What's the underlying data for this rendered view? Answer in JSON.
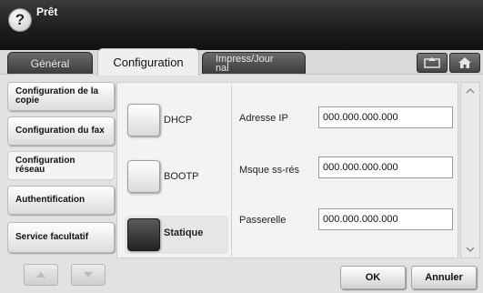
{
  "header": {
    "status": "Prêt",
    "help_symbol": "?"
  },
  "tabs": [
    {
      "label": "Général"
    },
    {
      "label": "Configuration"
    },
    {
      "label": "Impress/Jour nal"
    }
  ],
  "sidebar": {
    "items": [
      {
        "label": "Configuration de la copie"
      },
      {
        "label": "Configuration du fax"
      },
      {
        "label": "Configuration réseau"
      },
      {
        "label": "Authentification"
      },
      {
        "label": "Service facultatif"
      }
    ]
  },
  "ip_mode": {
    "options": [
      {
        "label": "DHCP"
      },
      {
        "label": "BOOTP"
      },
      {
        "label": "Statique"
      }
    ],
    "selected": "Statique"
  },
  "fields": {
    "ip": {
      "label": "Adresse IP",
      "value": "000.000.000.000"
    },
    "mask": {
      "label": "Msque ss-rés",
      "value": "000.000.000.000"
    },
    "gateway": {
      "label": "Passerelle",
      "value": "000.000.000.000"
    }
  },
  "buttons": {
    "ok": "OK",
    "cancel": "Annuler"
  },
  "icons": {
    "help": "help-icon",
    "back": "back-icon",
    "home": "home-icon",
    "scroll_up": "chevron-up-icon",
    "scroll_down": "chevron-down-icon"
  }
}
